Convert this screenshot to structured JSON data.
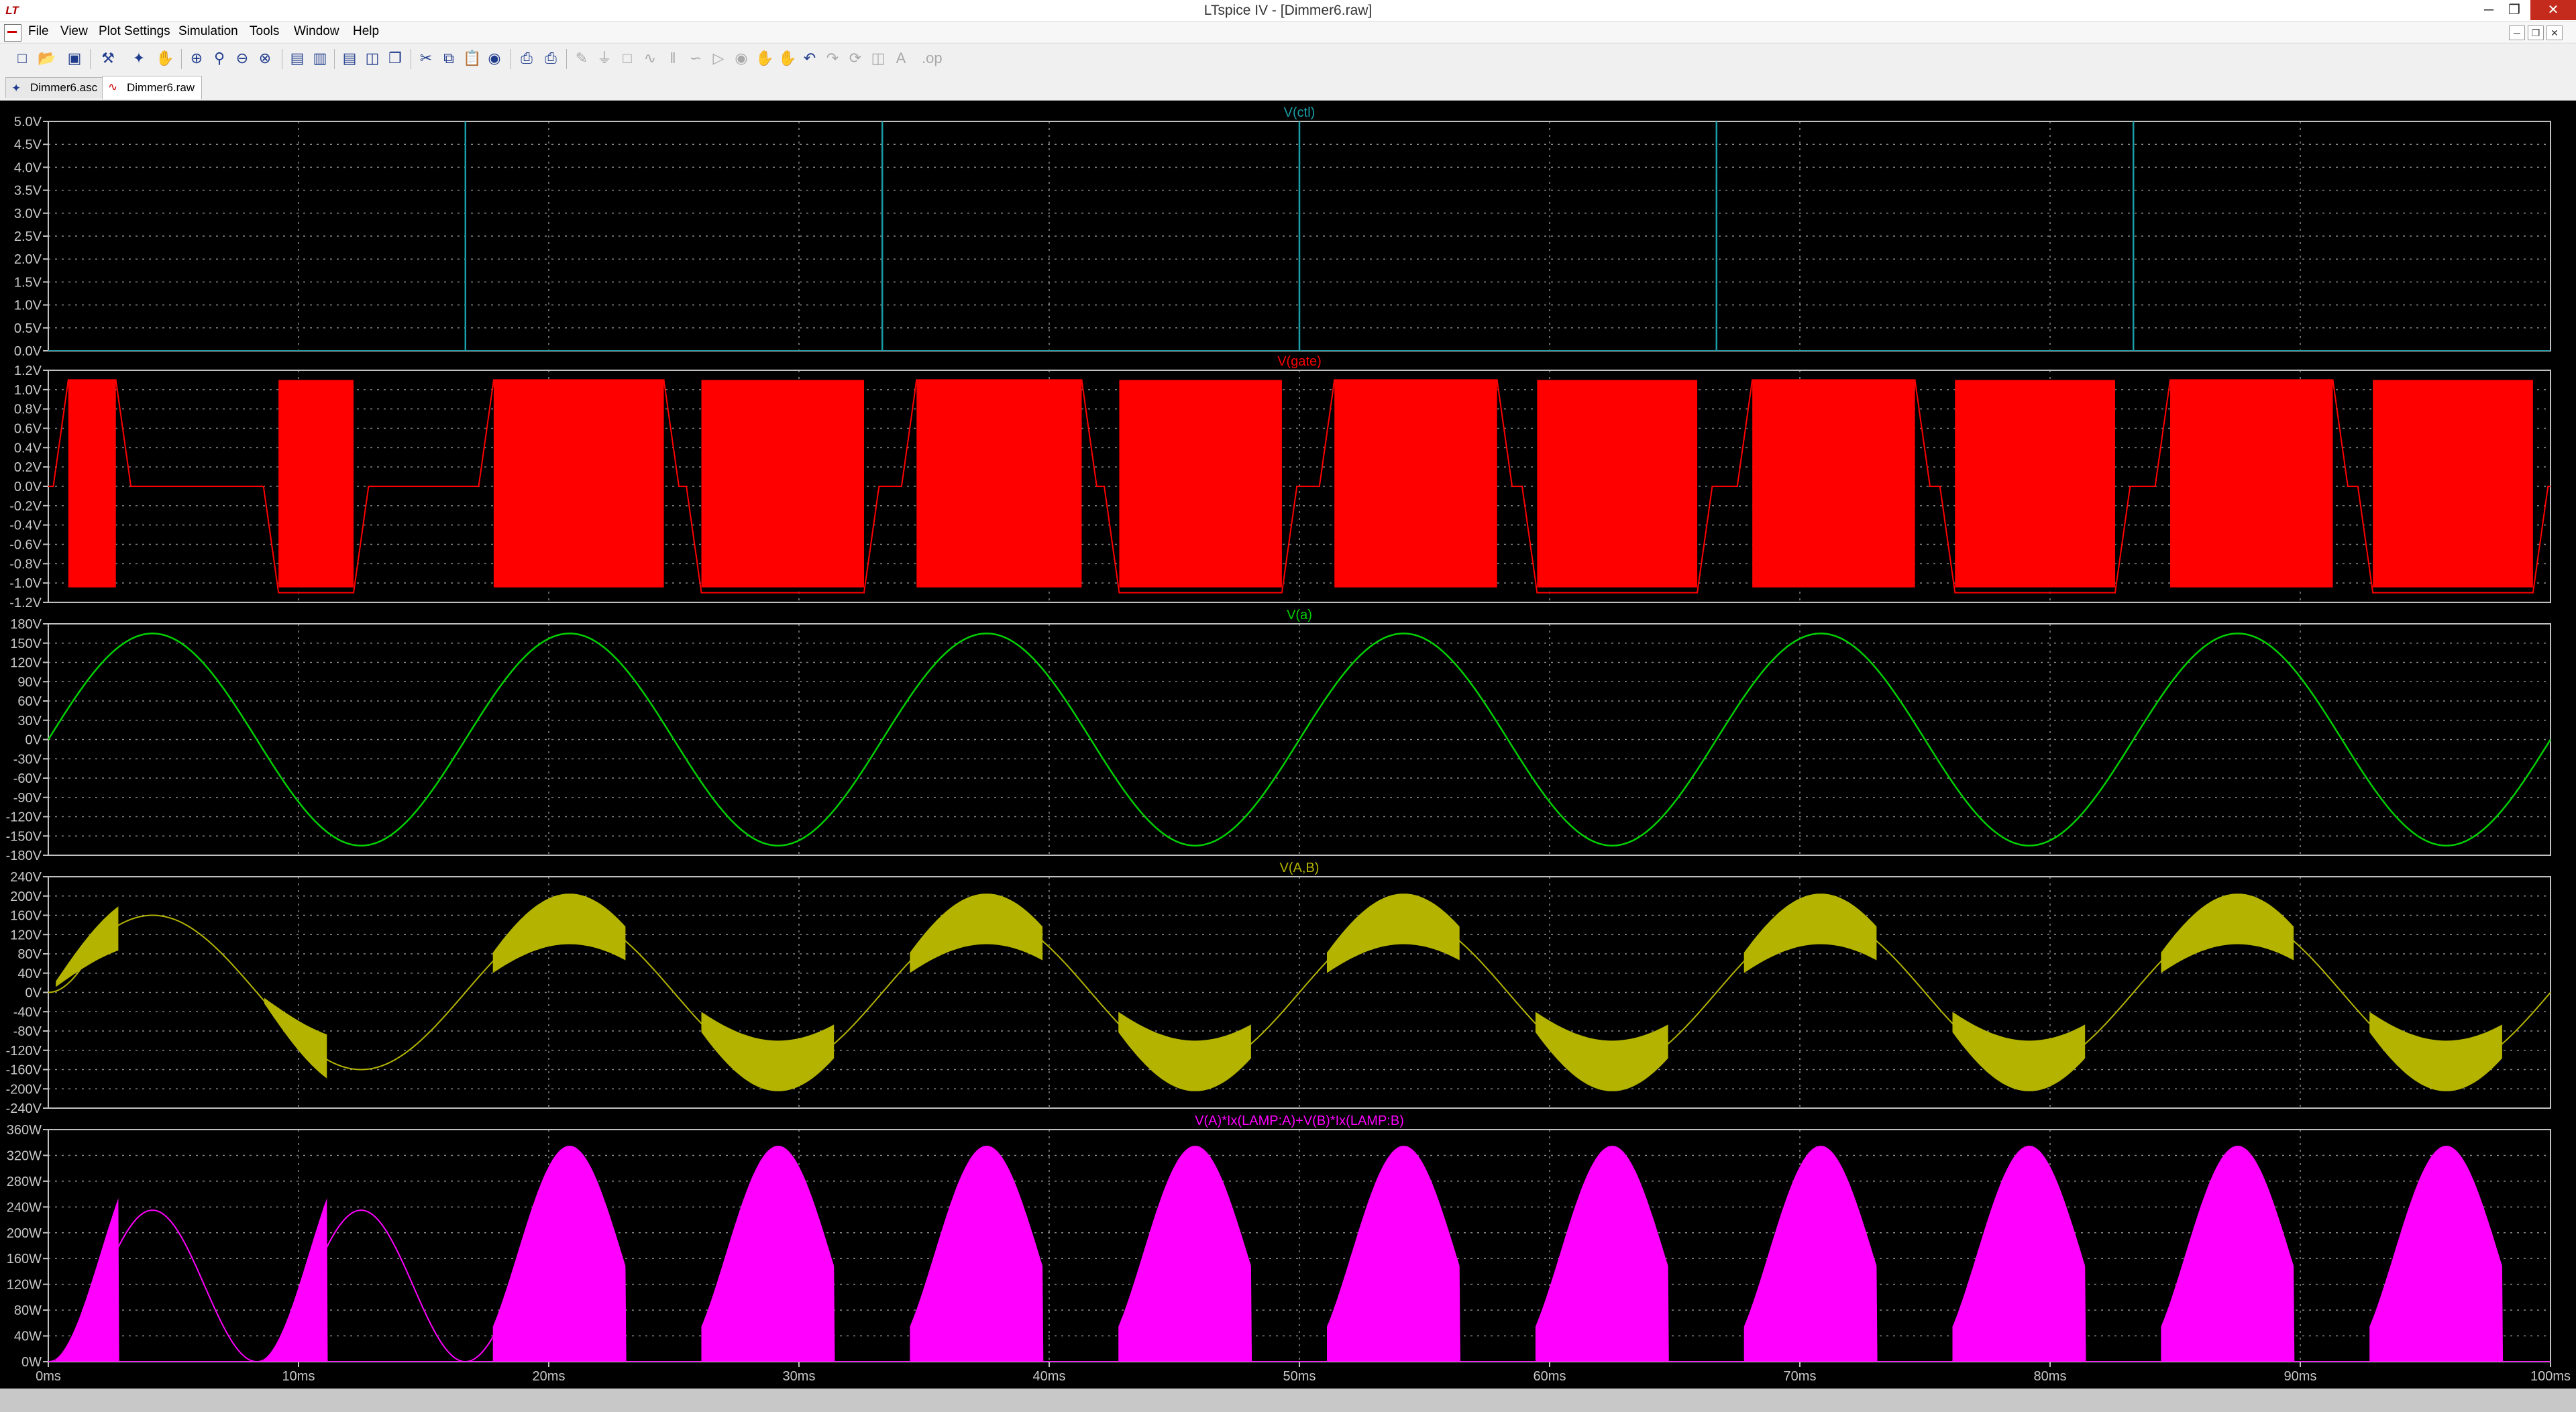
{
  "window": {
    "title": "LTspice IV - [Dimmer6.raw]",
    "minimize_glyph": "─",
    "restore_glyph": "❐",
    "close_glyph": "✕"
  },
  "menu": [
    "File",
    "View",
    "Plot Settings",
    "Simulation",
    "Tools",
    "Window",
    "Help"
  ],
  "mdi_buttons": [
    "─",
    "❐",
    "✕"
  ],
  "toolbar": {
    "icons": [
      "new-schematic",
      "open",
      "save",
      "control-panel",
      "run",
      "halt",
      "zoom-in",
      "pan",
      "zoom-out",
      "zoom-fit",
      "autorange",
      "tile-horizontal",
      "tile-vertical",
      "cascade",
      "cut",
      "copy",
      "paste",
      "find",
      "print-preview",
      "print",
      "draw-wire",
      "ground",
      "label",
      "resistor",
      "capacitor",
      "inductor",
      "diode",
      "component",
      "move",
      "drag",
      "undo",
      "redo",
      "rotate",
      "mirror",
      "text",
      "spice-directive"
    ]
  },
  "tabs": [
    {
      "label": "Dimmer6.asc",
      "icon": "schematic-icon"
    },
    {
      "label": "Dimmer6.raw",
      "icon": "waveform-icon"
    }
  ],
  "colors": {
    "background": "#000000",
    "frame": "#c0c0c0",
    "grid": "#8a8a8a",
    "ctrl": "#1a9ea7",
    "gate": "#ff0000",
    "va": "#00d000",
    "vab": "#b4b400",
    "power": "#ff00ff"
  },
  "chart_data": {
    "type": "line",
    "x_axis": {
      "range_ms": [
        0,
        100
      ],
      "tick_labels": [
        "0ms",
        "10ms",
        "20ms",
        "30ms",
        "40ms",
        "50ms",
        "60ms",
        "70ms",
        "80ms",
        "90ms",
        "100ms"
      ],
      "grid": true
    },
    "panes": [
      {
        "title": "V(ctl)",
        "color": "#1a9ea7",
        "ylim": [
          0,
          5
        ],
        "y_ticks": [
          "5.0V",
          "4.5V",
          "4.0V",
          "3.5V",
          "3.0V",
          "2.5V",
          "2.0V",
          "1.5V",
          "1.0V",
          "0.5V",
          "0.0V"
        ],
        "pulse_times_ms": [
          16.67,
          33.33,
          50.0,
          66.67,
          83.33
        ],
        "pulse_high_v": 5.0,
        "baseline_v": 0.0
      },
      {
        "title": "V(gate)",
        "color": "#ff0000",
        "ylim": [
          -1.2,
          1.2
        ],
        "y_ticks": [
          "1.2V",
          "1.0V",
          "0.8V",
          "0.6V",
          "0.4V",
          "0.2V",
          "0.0V",
          "-0.2V",
          "-0.4V",
          "-0.6V",
          "-0.8V",
          "-1.0V",
          "-1.2V"
        ],
        "bursts": [
          {
            "start_ms": 0.8,
            "end_ms": 2.7,
            "level_v": 1.1
          },
          {
            "start_ms": 9.2,
            "end_ms": 12.2,
            "level_v": -1.1
          },
          {
            "start_ms": 17.8,
            "end_ms": 24.6,
            "level_v": 1.1
          },
          {
            "start_ms": 26.1,
            "end_ms": 32.6,
            "level_v": -1.1
          },
          {
            "start_ms": 34.7,
            "end_ms": 41.3,
            "level_v": 1.1
          },
          {
            "start_ms": 42.8,
            "end_ms": 49.3,
            "level_v": -1.1
          },
          {
            "start_ms": 51.4,
            "end_ms": 57.9,
            "level_v": 1.1
          },
          {
            "start_ms": 59.5,
            "end_ms": 65.9,
            "level_v": -1.1
          },
          {
            "start_ms": 68.1,
            "end_ms": 74.6,
            "level_v": 1.1
          },
          {
            "start_ms": 76.2,
            "end_ms": 82.6,
            "level_v": -1.1
          },
          {
            "start_ms": 84.8,
            "end_ms": 91.3,
            "level_v": 1.1
          },
          {
            "start_ms": 92.9,
            "end_ms": 99.3,
            "level_v": -1.1
          }
        ]
      },
      {
        "title": "V(a)",
        "color": "#00d000",
        "ylim": [
          -180,
          180
        ],
        "y_ticks": [
          "180V",
          "150V",
          "120V",
          "90V",
          "60V",
          "30V",
          "0V",
          "-30V",
          "-60V",
          "-90V",
          "-120V",
          "-150V",
          "-180V"
        ],
        "amplitude_v": 165,
        "frequency_hz": 60
      },
      {
        "title": "V(A,B)",
        "color": "#b4b400",
        "ylim": [
          -240,
          240
        ],
        "y_ticks": [
          "240V",
          "200V",
          "160V",
          "120V",
          "80V",
          "40V",
          "0V",
          "-40V",
          "-80V",
          "-120V",
          "-160V",
          "-200V",
          "-240V"
        ],
        "envelope_peak_high_v": 205,
        "envelope_peak_low_v": 100
      },
      {
        "title": "V(A)*Ix(LAMP:A)+V(B)*Ix(LAMP:B)",
        "color": "#ff00ff",
        "ylim": [
          0,
          360
        ],
        "y_ticks": [
          "360W",
          "320W",
          "280W",
          "240W",
          "200W",
          "160W",
          "120W",
          "80W",
          "40W",
          "0W"
        ],
        "envelope_peak_high_w": 335,
        "envelope_peak_low_w": 90
      }
    ]
  }
}
